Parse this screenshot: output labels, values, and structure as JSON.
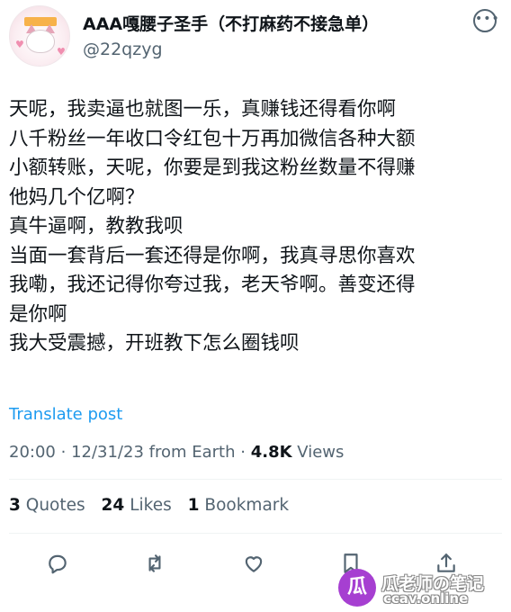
{
  "author": {
    "display_name": "AAA嘎腰子圣手（不打麻药不接急单）",
    "handle": "@22qzyg",
    "avatar": "cat-avatar"
  },
  "tweet": {
    "lines": [
      "天呢，我卖逼也就图一乐，真赚钱还得看你啊",
      "八千粉丝一年收口令红包十万再加微信各种大额",
      "小额转账，天呢，你要是到我这粉丝数量不得赚",
      "他妈几个亿啊？",
      "真牛逼啊，教教我呗",
      "当面一套背后一套还得是你啊，我真寻思你喜欢",
      "我嘞，我还记得你夸过我，老天爷啊。善变还得",
      "是你啊",
      "我大受震撼，开班教下怎么圈钱呗"
    ],
    "translate_label": "Translate post"
  },
  "meta": {
    "time": "20:00",
    "date": "12/31/23",
    "source": "from Earth",
    "views_count": "4.8K",
    "views_label": "Views"
  },
  "stats": {
    "quotes_count": "3",
    "quotes_label": "Quotes",
    "likes_count": "24",
    "likes_label": "Likes",
    "bookmarks_count": "1",
    "bookmarks_label": "Bookmark"
  },
  "actions": [
    "reply-icon",
    "repost-icon",
    "like-icon",
    "bookmark-icon",
    "share-icon"
  ],
  "watermark": {
    "logo_glyph": "瓜",
    "title": "瓜老师の笔记",
    "url": "ccav.online"
  },
  "colors": {
    "text": "#0f1419",
    "secondary": "#536471",
    "link": "#1d9bf0",
    "divider": "#eff3f4",
    "watermark_purple": "#a63fd1"
  }
}
